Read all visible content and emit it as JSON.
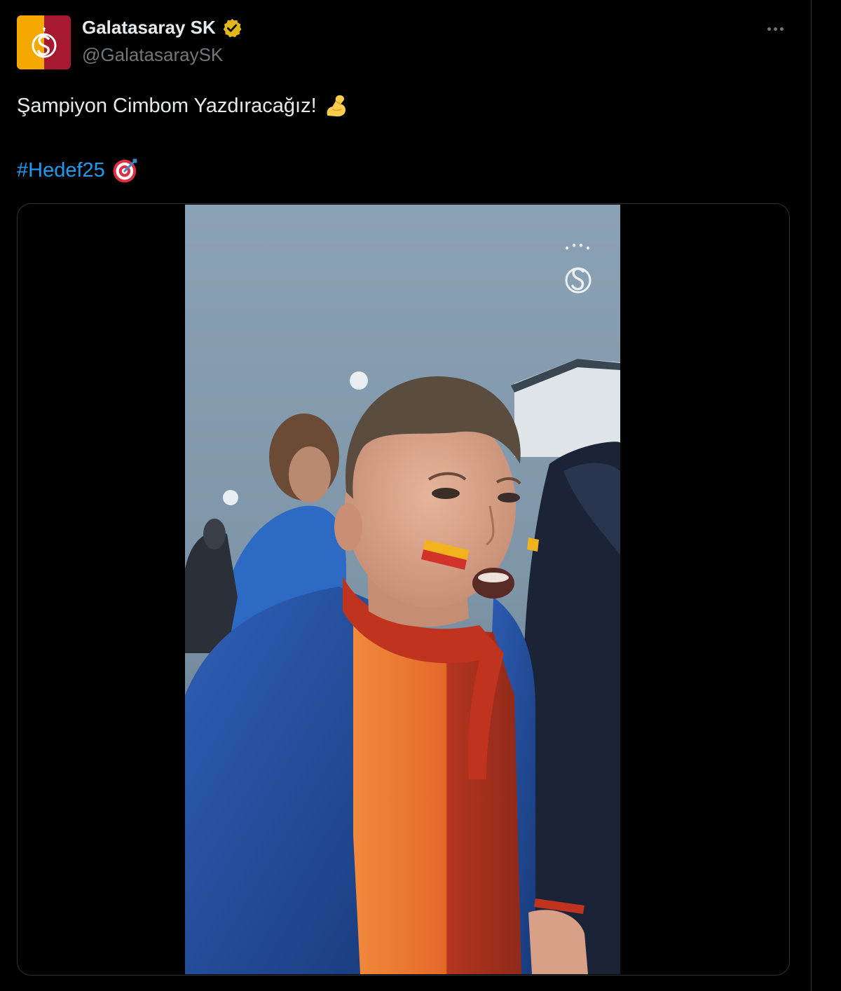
{
  "tweet": {
    "author": {
      "display_name": "Galatasaray SK",
      "handle": "@GalatasaraySK",
      "verified": true,
      "avatar_colors": [
        "#f5a800",
        "#a6192e"
      ]
    },
    "text": "Şampiyon Cimbom Yazdıracağız!",
    "text_emoji": "flexed-biceps-emoji",
    "hashtag": "#Hedef25",
    "hashtag_emoji": "direct-hit-emoji",
    "more_icon": "ellipsis-icon"
  },
  "media": {
    "type": "video",
    "watermark_icon": "galatasaray-crest-icon"
  },
  "colors": {
    "background": "#000000",
    "text": "#e7e9ea",
    "secondary_text": "#71767b",
    "link": "#1d9bf0",
    "border": "#2f3336",
    "verified_badge": "#e2b719"
  }
}
